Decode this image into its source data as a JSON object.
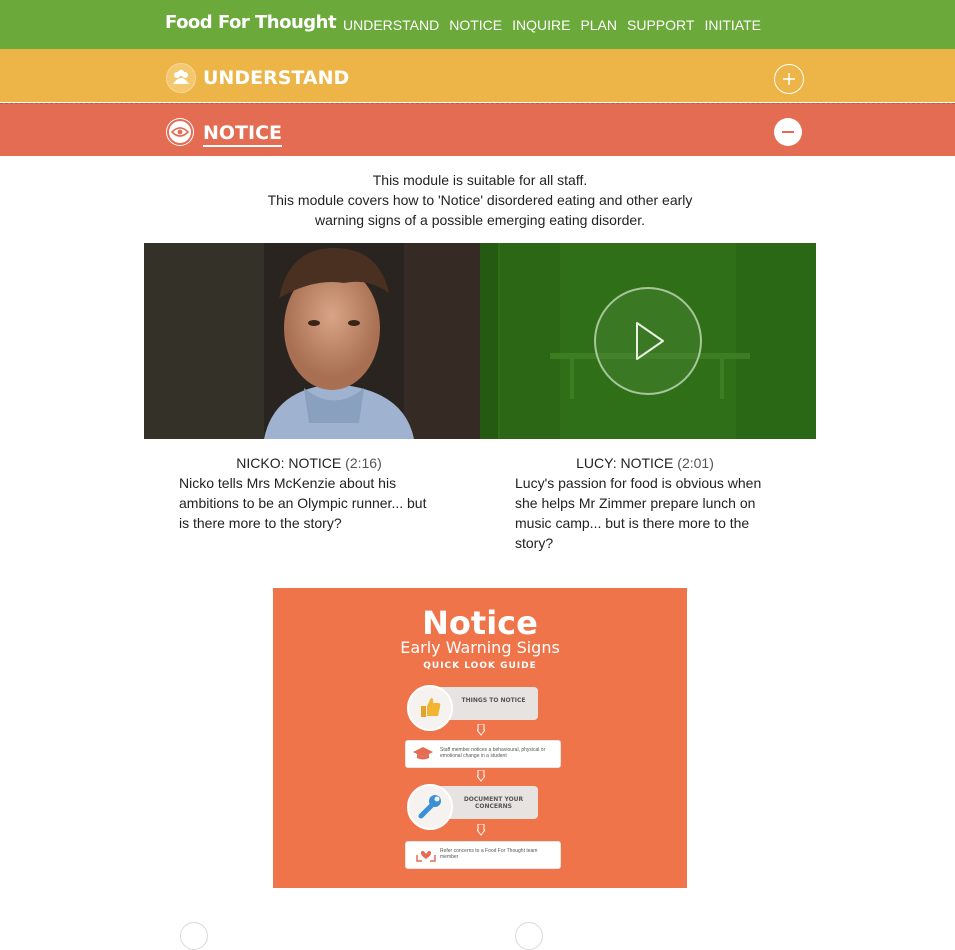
{
  "brand": "Food For Thought",
  "nav": [
    "UNDERSTAND",
    "NOTICE",
    "INQUIRE",
    "PLAN",
    "SUPPORT",
    "INITIATE"
  ],
  "sections": {
    "understand": {
      "title": "UNDERSTAND",
      "icon": "people-icon",
      "toggle": "plus-icon",
      "color": "#edb548"
    },
    "notice": {
      "title": "NOTICE",
      "icon": "eye-icon",
      "toggle": "minus-icon",
      "color": "#e46c53"
    }
  },
  "intro": {
    "line1": "This module is suitable for all staff.",
    "line2": "This module covers how to 'Notice' disordered eating and other early warning signs of a possible emerging eating disorder."
  },
  "videos": [
    {
      "title": "NICKO: NOTICE",
      "duration": "(2:16)",
      "description": "Nicko tells Mrs McKenzie about his ambitions to be an Olympic runner... but is there more to the story?"
    },
    {
      "title": "LUCY: NOTICE",
      "duration": "(2:01)",
      "description": "Lucy's passion for food is obvious when she helps Mr Zimmer prepare lunch on music camp... but is there more to the story?"
    }
  ],
  "poster": {
    "title": "Notice",
    "subtitle": "Early Warning Signs",
    "tagline": "QUICK LOOK GUIDE",
    "step1": "THINGS TO NOTICE",
    "step1_detail": "Staff member notices a behavioural, physical or emotional change in a student",
    "step2": "DOCUMENT YOUR CONCERNS",
    "step2_detail": "Refer concerns to a Food For Thought team member"
  },
  "colors": {
    "nav": "#6aa93a",
    "understand": "#edb548",
    "notice": "#e46c53",
    "poster": "#f0744a",
    "video_overlay": "#2d6d16"
  }
}
